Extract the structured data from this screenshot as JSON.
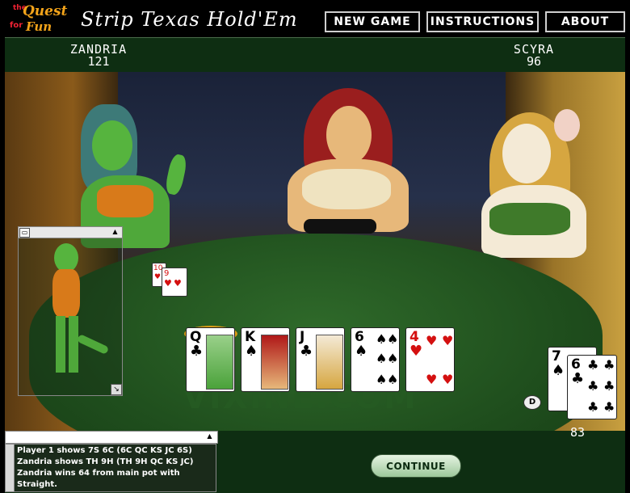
{
  "logo": {
    "line1": "Quest",
    "line2": "Fun",
    "the": "the",
    "of": "for"
  },
  "title": "Strip Texas Hold'Em",
  "nav": {
    "new_game": "NEW GAME",
    "instructions": "INSTRUCTIONS",
    "about": "ABOUT"
  },
  "players": {
    "left": {
      "name": "ZANDRIA",
      "score": "121"
    },
    "right": {
      "name": "SCYRA",
      "score": "96"
    },
    "me": {
      "score": "83"
    }
  },
  "watermark": "VIXINE.COM",
  "community_cards": [
    {
      "rank": "Q",
      "suit": "♣",
      "color": "black"
    },
    {
      "rank": "K",
      "suit": "♠",
      "color": "black"
    },
    {
      "rank": "J",
      "suit": "♣",
      "color": "black"
    },
    {
      "rank": "6",
      "suit": "♠",
      "color": "black"
    },
    {
      "rank": "4",
      "suit": "♥",
      "color": "red"
    }
  ],
  "zandria_cards": [
    {
      "rank": "10",
      "suit": "♥"
    },
    {
      "rank": "9",
      "suit": "♥"
    }
  ],
  "my_cards": [
    {
      "rank": "7",
      "suit": "♠"
    },
    {
      "rank": "6",
      "suit": "♣"
    }
  ],
  "dealer_label": "D",
  "log": [
    "Player 1 shows 7S 6C (6C QC KS JC 6S)",
    "Zandria shows TH 9H (TH 9H QC KS JC)",
    "Zandria wins 64 from main pot with",
    "Straight."
  ],
  "continue_label": "CONTINUE",
  "icons": {
    "maximize": "maximize-icon",
    "scroll_up": "arrow-up-icon",
    "resize": "resize-icon"
  },
  "colors": {
    "felt": "#1f4e1d",
    "panel": "#0e2e12",
    "accent": "#f2a31a"
  }
}
